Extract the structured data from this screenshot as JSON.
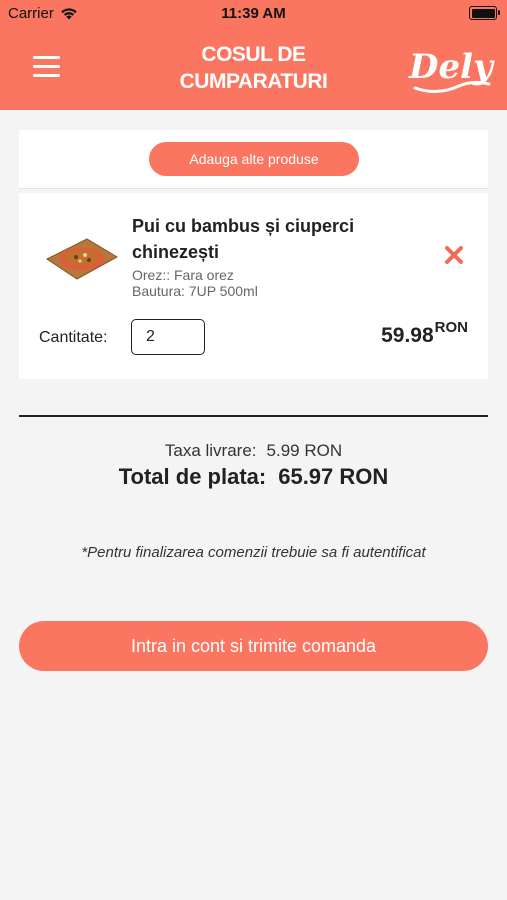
{
  "status_bar": {
    "carrier": "Carrier",
    "time": "11:39 AM",
    "wifi_icon": "wifi-icon",
    "battery_icon": "battery-icon"
  },
  "header": {
    "title_line1": "COSUL DE",
    "title_line2": "CUMPARATURI",
    "logo_text": "Dely",
    "menu_icon": "hamburger-menu-icon"
  },
  "cart": {
    "add_more_label": "Adauga alte produse",
    "item": {
      "name": "Pui cu bambus și ciuperci chinezești",
      "option_1": "Orez:: Fara orez",
      "option_2": "Bautura: 7UP 500ml",
      "quantity_label": "Cantitate:",
      "quantity_value": "2",
      "price": "59.98",
      "currency": "RON",
      "remove_icon": "close-x-icon",
      "image_icon": "food-plate-image"
    }
  },
  "summary": {
    "delivery_label": "Taxa livrare:",
    "delivery_value": "5.99 RON",
    "total_label": "Total de plata:",
    "total_value": "65.97 RON"
  },
  "auth_note": "*Pentru finalizarea comenzii trebuie sa fi autentificat",
  "submit_label": "Intra in cont si trimite comanda",
  "colors": {
    "accent": "#fa7660",
    "background": "#f4f4f4",
    "card": "#ffffff"
  }
}
